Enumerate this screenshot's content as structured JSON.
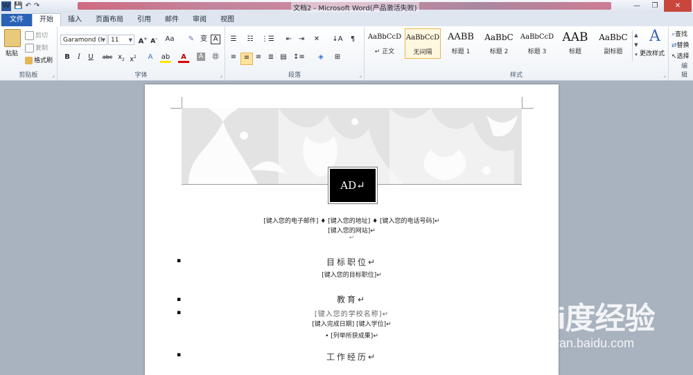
{
  "window": {
    "title": "文档2 - Microsoft Word(产品激活失败)",
    "minimize": "—",
    "restore": "❐",
    "close": "✕"
  },
  "qat": {
    "logo": "W",
    "save": "💾",
    "undo": "↶",
    "redo": "↷"
  },
  "tabs": [
    {
      "label": "文件"
    },
    {
      "label": "开始"
    },
    {
      "label": "插入"
    },
    {
      "label": "页面布局"
    },
    {
      "label": "引用"
    },
    {
      "label": "邮件"
    },
    {
      "label": "审阅"
    },
    {
      "label": "视图"
    }
  ],
  "ribbon": {
    "clipboard": {
      "label": "剪贴板",
      "paste": "粘贴",
      "cut": "剪切",
      "copy": "复制",
      "format_painter": "格式刷"
    },
    "font": {
      "label": "字体",
      "name": "Garamond (I",
      "size": "11"
    },
    "paragraph": {
      "label": "段落"
    },
    "styles": {
      "label": "样式",
      "items": [
        {
          "sample": "AaBbCcD",
          "name": "↵ 正文"
        },
        {
          "sample": "AaBbCcD",
          "name": "无间隔"
        },
        {
          "sample": "AABB",
          "name": "标题 1"
        },
        {
          "sample": "AaBbC",
          "name": "标题 2"
        },
        {
          "sample": "AaBbCcD",
          "name": "标题 3"
        },
        {
          "sample": "AAB",
          "name": "标题"
        },
        {
          "sample": "AaBbC",
          "name": "副标题"
        }
      ],
      "change_styles": "更改样式"
    },
    "editing": {
      "label": "编辑",
      "find": "查找",
      "replace": "替换",
      "select": "选择"
    }
  },
  "document": {
    "ad_text": "AD↵",
    "contact_line1": "[键入您的电子邮件] ♦ [键入您的地址] ♦ [键入您的电话号码]↵",
    "contact_line2": "[键入您的网站]↵",
    "empty_para": "↵",
    "section1_title": "目标职位↵",
    "section1_text": "[键入您的目标职位]↵",
    "section2_title": "教育↵",
    "section2_school": "[键入您的学校名称]↵",
    "section2_date": "[键入完成日期] [键入学位]↵",
    "section2_achieve": "• [列举所获成果]↵",
    "section3_title": "工作经历↵",
    "bullet": "▪"
  },
  "watermark": {
    "brand": "Bai度经验",
    "url": "jingyan.baidu.com"
  },
  "colors": {
    "file_tab": "#2a63b6",
    "selected_style": "#e8b44c"
  }
}
